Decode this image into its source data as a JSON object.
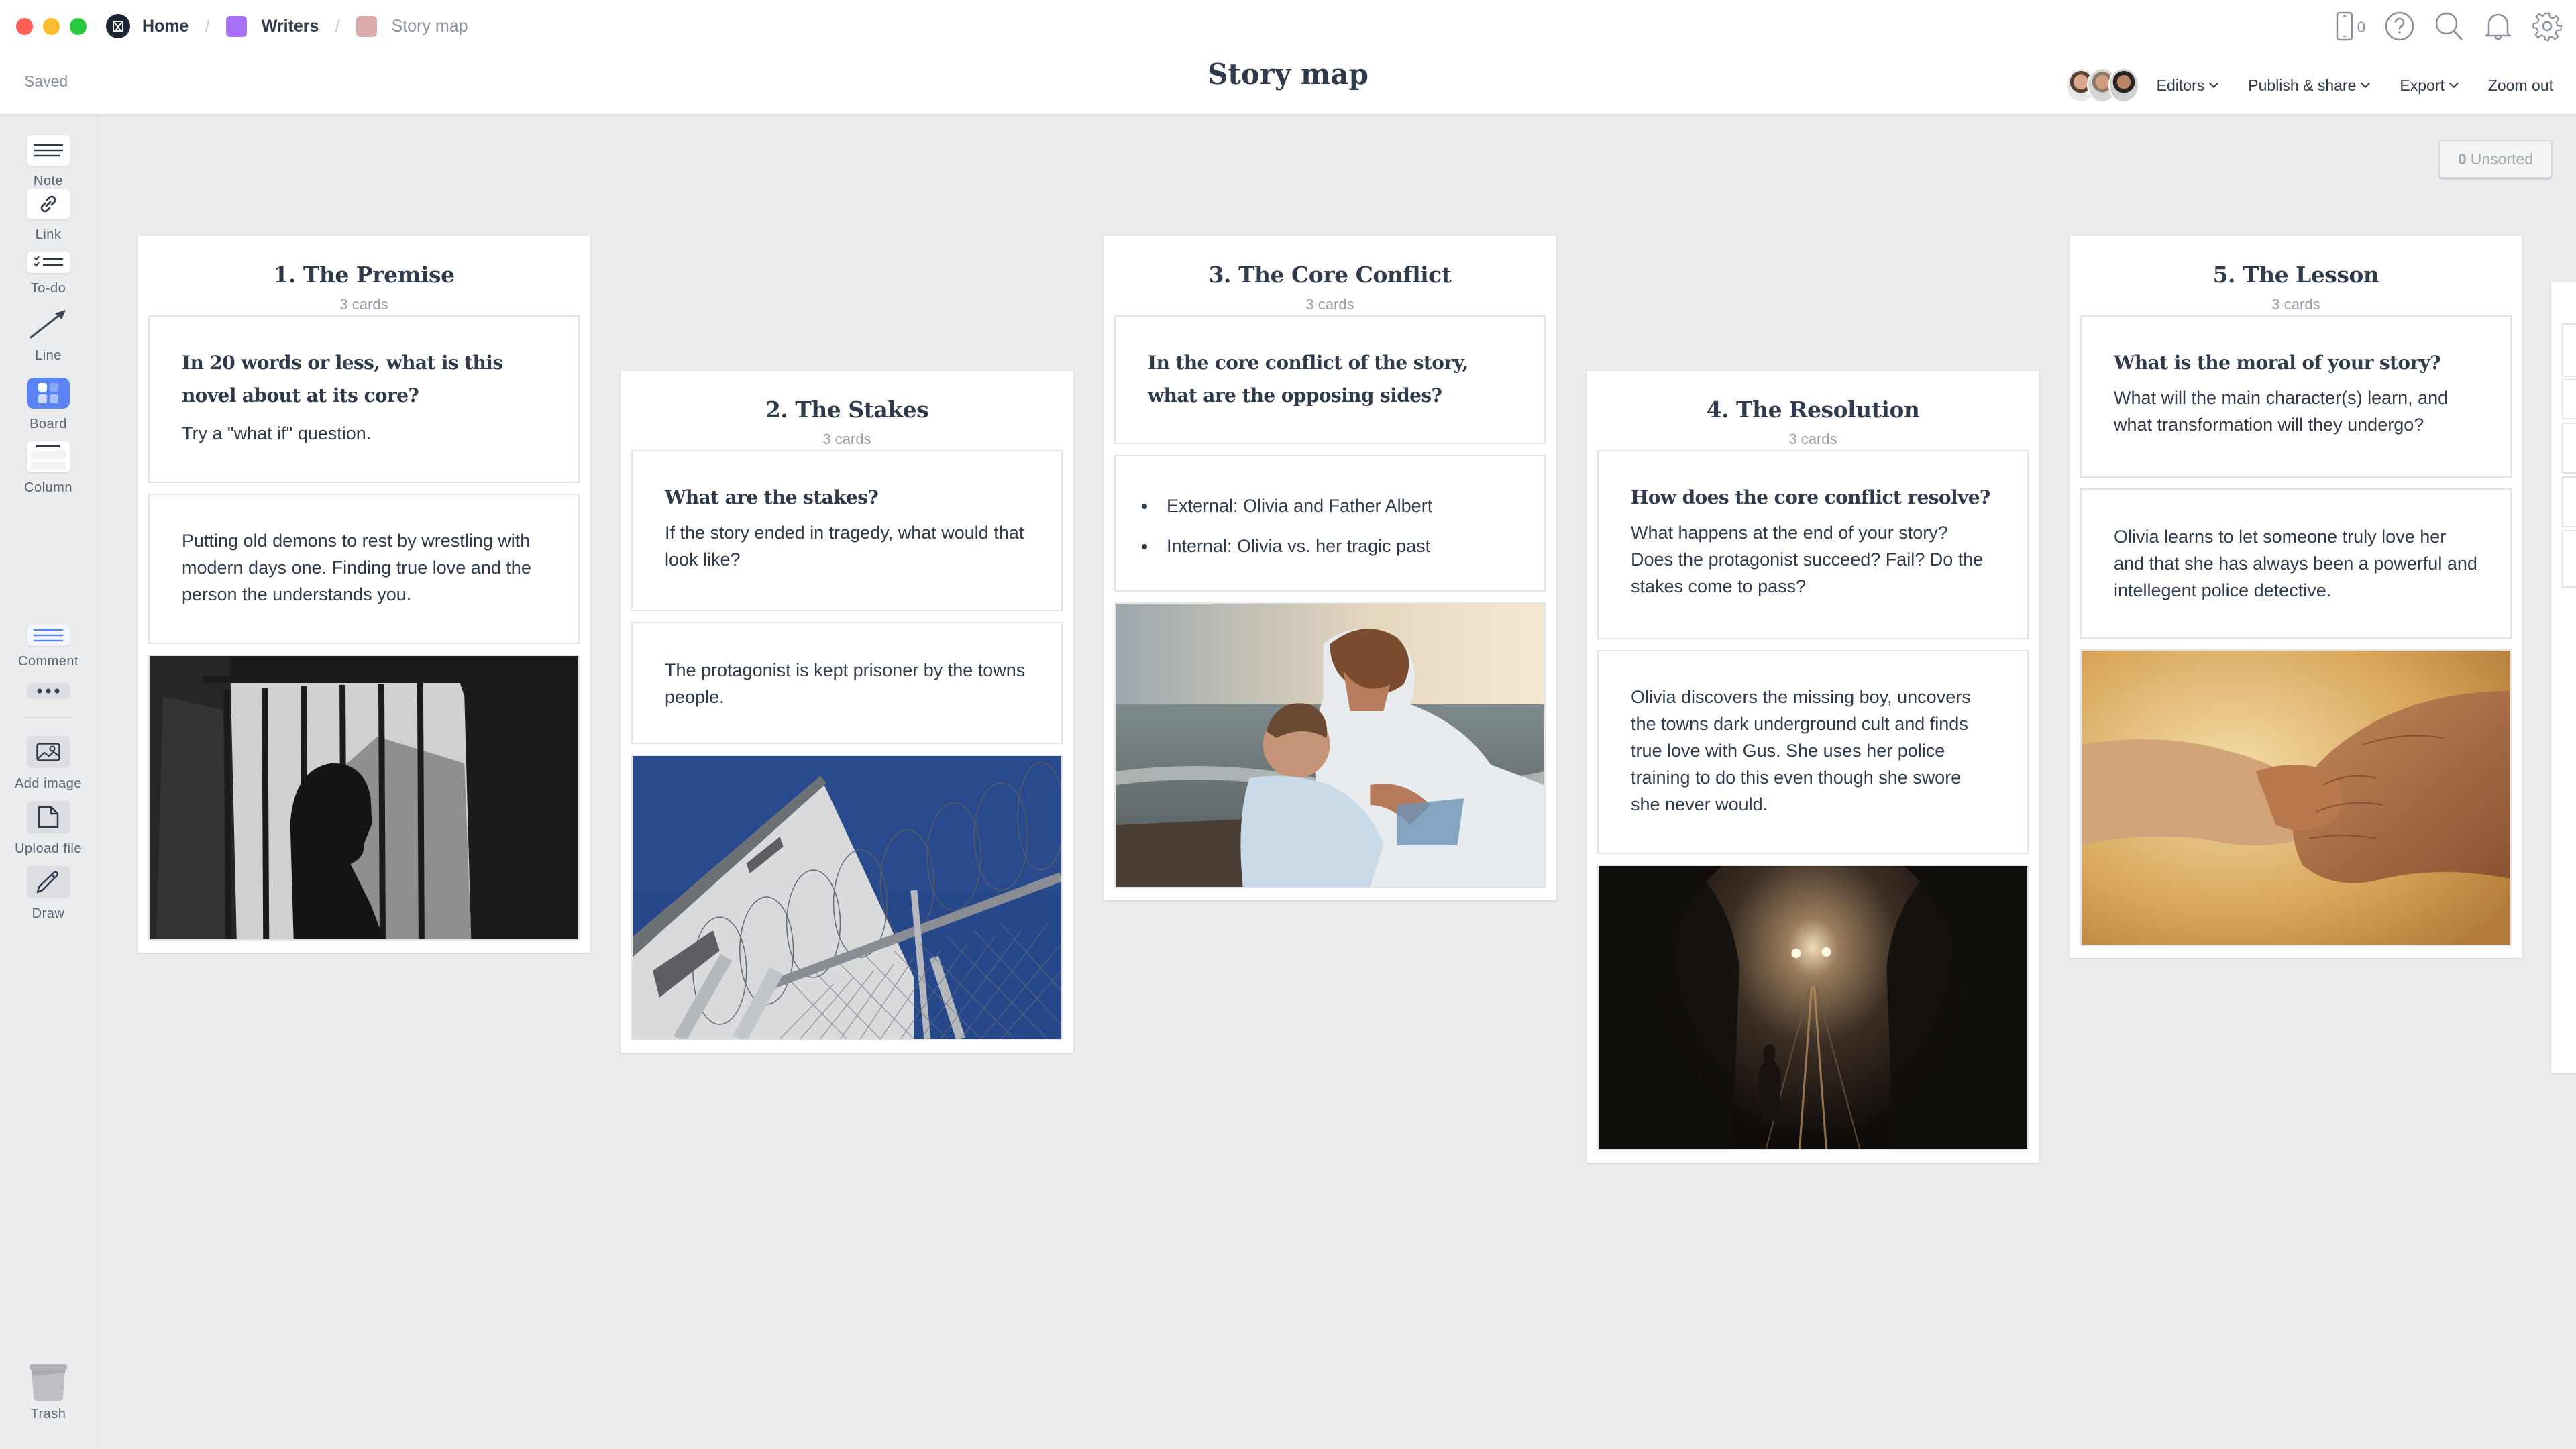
{
  "window": {
    "traffic_lights": [
      "close",
      "minimize",
      "maximize"
    ]
  },
  "breadcrumb": [
    {
      "label": "Home",
      "icon": "milanote-logo",
      "color": "#1a2433"
    },
    {
      "label": "Writers",
      "icon": "board-square",
      "color": "#a971f7"
    },
    {
      "label": "Story map",
      "icon": "board-square",
      "color": "#dbaaab"
    }
  ],
  "header": {
    "status": "Saved",
    "title": "Story map",
    "device_count": "0",
    "icons": [
      "device-icon",
      "help-icon",
      "search-icon",
      "bell-icon",
      "gear-icon"
    ],
    "actions": {
      "editors": "Editors",
      "publish": "Publish & share",
      "export": "Export",
      "zoom_out": "Zoom out"
    },
    "editor_avatars": 3
  },
  "toolbar": {
    "items": [
      {
        "label": "Note",
        "icon": "note-icon"
      },
      {
        "label": "Link",
        "icon": "link-icon"
      },
      {
        "label": "To-do",
        "icon": "todo-icon"
      },
      {
        "label": "Line",
        "icon": "line-arrow-icon"
      },
      {
        "label": "Board",
        "icon": "board-icon"
      },
      {
        "label": "Column",
        "icon": "column-icon"
      },
      {
        "label": "Comment",
        "icon": "comment-icon"
      },
      {
        "label": "",
        "icon": "more-icon"
      },
      {
        "label": "Add image",
        "icon": "image-icon"
      },
      {
        "label": "Upload file",
        "icon": "file-icon"
      },
      {
        "label": "Draw",
        "icon": "pencil-icon"
      }
    ],
    "trash": "Trash"
  },
  "unsorted": {
    "count": "0",
    "label": "Unsorted"
  },
  "columns": [
    {
      "title": "1. The Premise",
      "count": "3 cards",
      "cards": [
        {
          "question": "In 20 words or less, what is this novel about at its core?",
          "text": "Try a \"what if\" question."
        },
        {
          "text": "Putting old demons to rest by wrestling with modern days one. Finding true love and the person the understands you."
        },
        {
          "image": "Silhouette of a woman behind prison bars"
        }
      ]
    },
    {
      "title": "2. The Stakes",
      "count": "3 cards",
      "cards": [
        {
          "question": "What are the stakes?",
          "text": "If the story ended in tragedy, what would that look like?"
        },
        {
          "text": "The protagonist is kept prisoner by the towns people."
        },
        {
          "image": "Prison wall with razor wire fence against blue sky"
        }
      ]
    },
    {
      "title": "3. The Core Conflict",
      "count": "3 cards",
      "cards": [
        {
          "question": "In the core conflict of the story, what are the opposing sides?"
        },
        {
          "bullets": [
            "External: Olivia and Father Albert",
            "Internal: Olivia vs. her tragic past"
          ]
        },
        {
          "image": "Mother embracing child on a beach at sunset"
        }
      ]
    },
    {
      "title": "4. The Resolution",
      "count": "3 cards",
      "cards": [
        {
          "question": "How does the core conflict resolve?",
          "text": "What happens at the end of your story? Does the protagonist succeed? Fail? Do the stakes come to pass?"
        },
        {
          "text": "Olivia discovers the missing boy, uncovers the towns dark underground cult and finds true love with Gus. She uses her police training to do this even though she swore she never would."
        },
        {
          "image": "Figure walking in a dark tunnel toward lights"
        }
      ]
    },
    {
      "title": "5. The Lesson",
      "count": "3 cards",
      "cards": [
        {
          "question": "What is the moral of your story?",
          "text": "What will the main character(s) learn, and what transformation will they undergo?"
        },
        {
          "text": "Olivia learns to let someone truly love her and that she has always been a powerful and intellegent police detective."
        },
        {
          "image": "Two hands clasped together in warm light"
        }
      ]
    }
  ]
}
